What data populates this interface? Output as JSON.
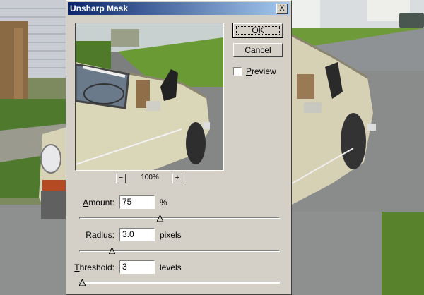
{
  "dialog": {
    "title": "Unsharp Mask",
    "close_label": "X",
    "ok_label": "OK",
    "cancel_label": "Cancel",
    "preview_checkbox": {
      "label": "Preview",
      "checked": false
    }
  },
  "zoom": {
    "minus_label": "−",
    "plus_label": "+",
    "level": "100%"
  },
  "params": {
    "amount": {
      "label": "Amount:",
      "value": "75",
      "unit": "%",
      "slider_fraction": 0.4
    },
    "radius": {
      "label": "Radius:",
      "value": "3.0",
      "unit": "pixels",
      "slider_fraction": 0.16
    },
    "threshold": {
      "label": "Threshold:",
      "value": "3",
      "unit": "levels",
      "slider_fraction": 0.01
    }
  },
  "icons": {
    "close": "close-icon",
    "slider_thumb": "triangle-thumb-icon"
  },
  "colors": {
    "titlebar_start": "#0a246a",
    "titlebar_end": "#a6caf0",
    "dialog_face": "#d4d0c8"
  }
}
